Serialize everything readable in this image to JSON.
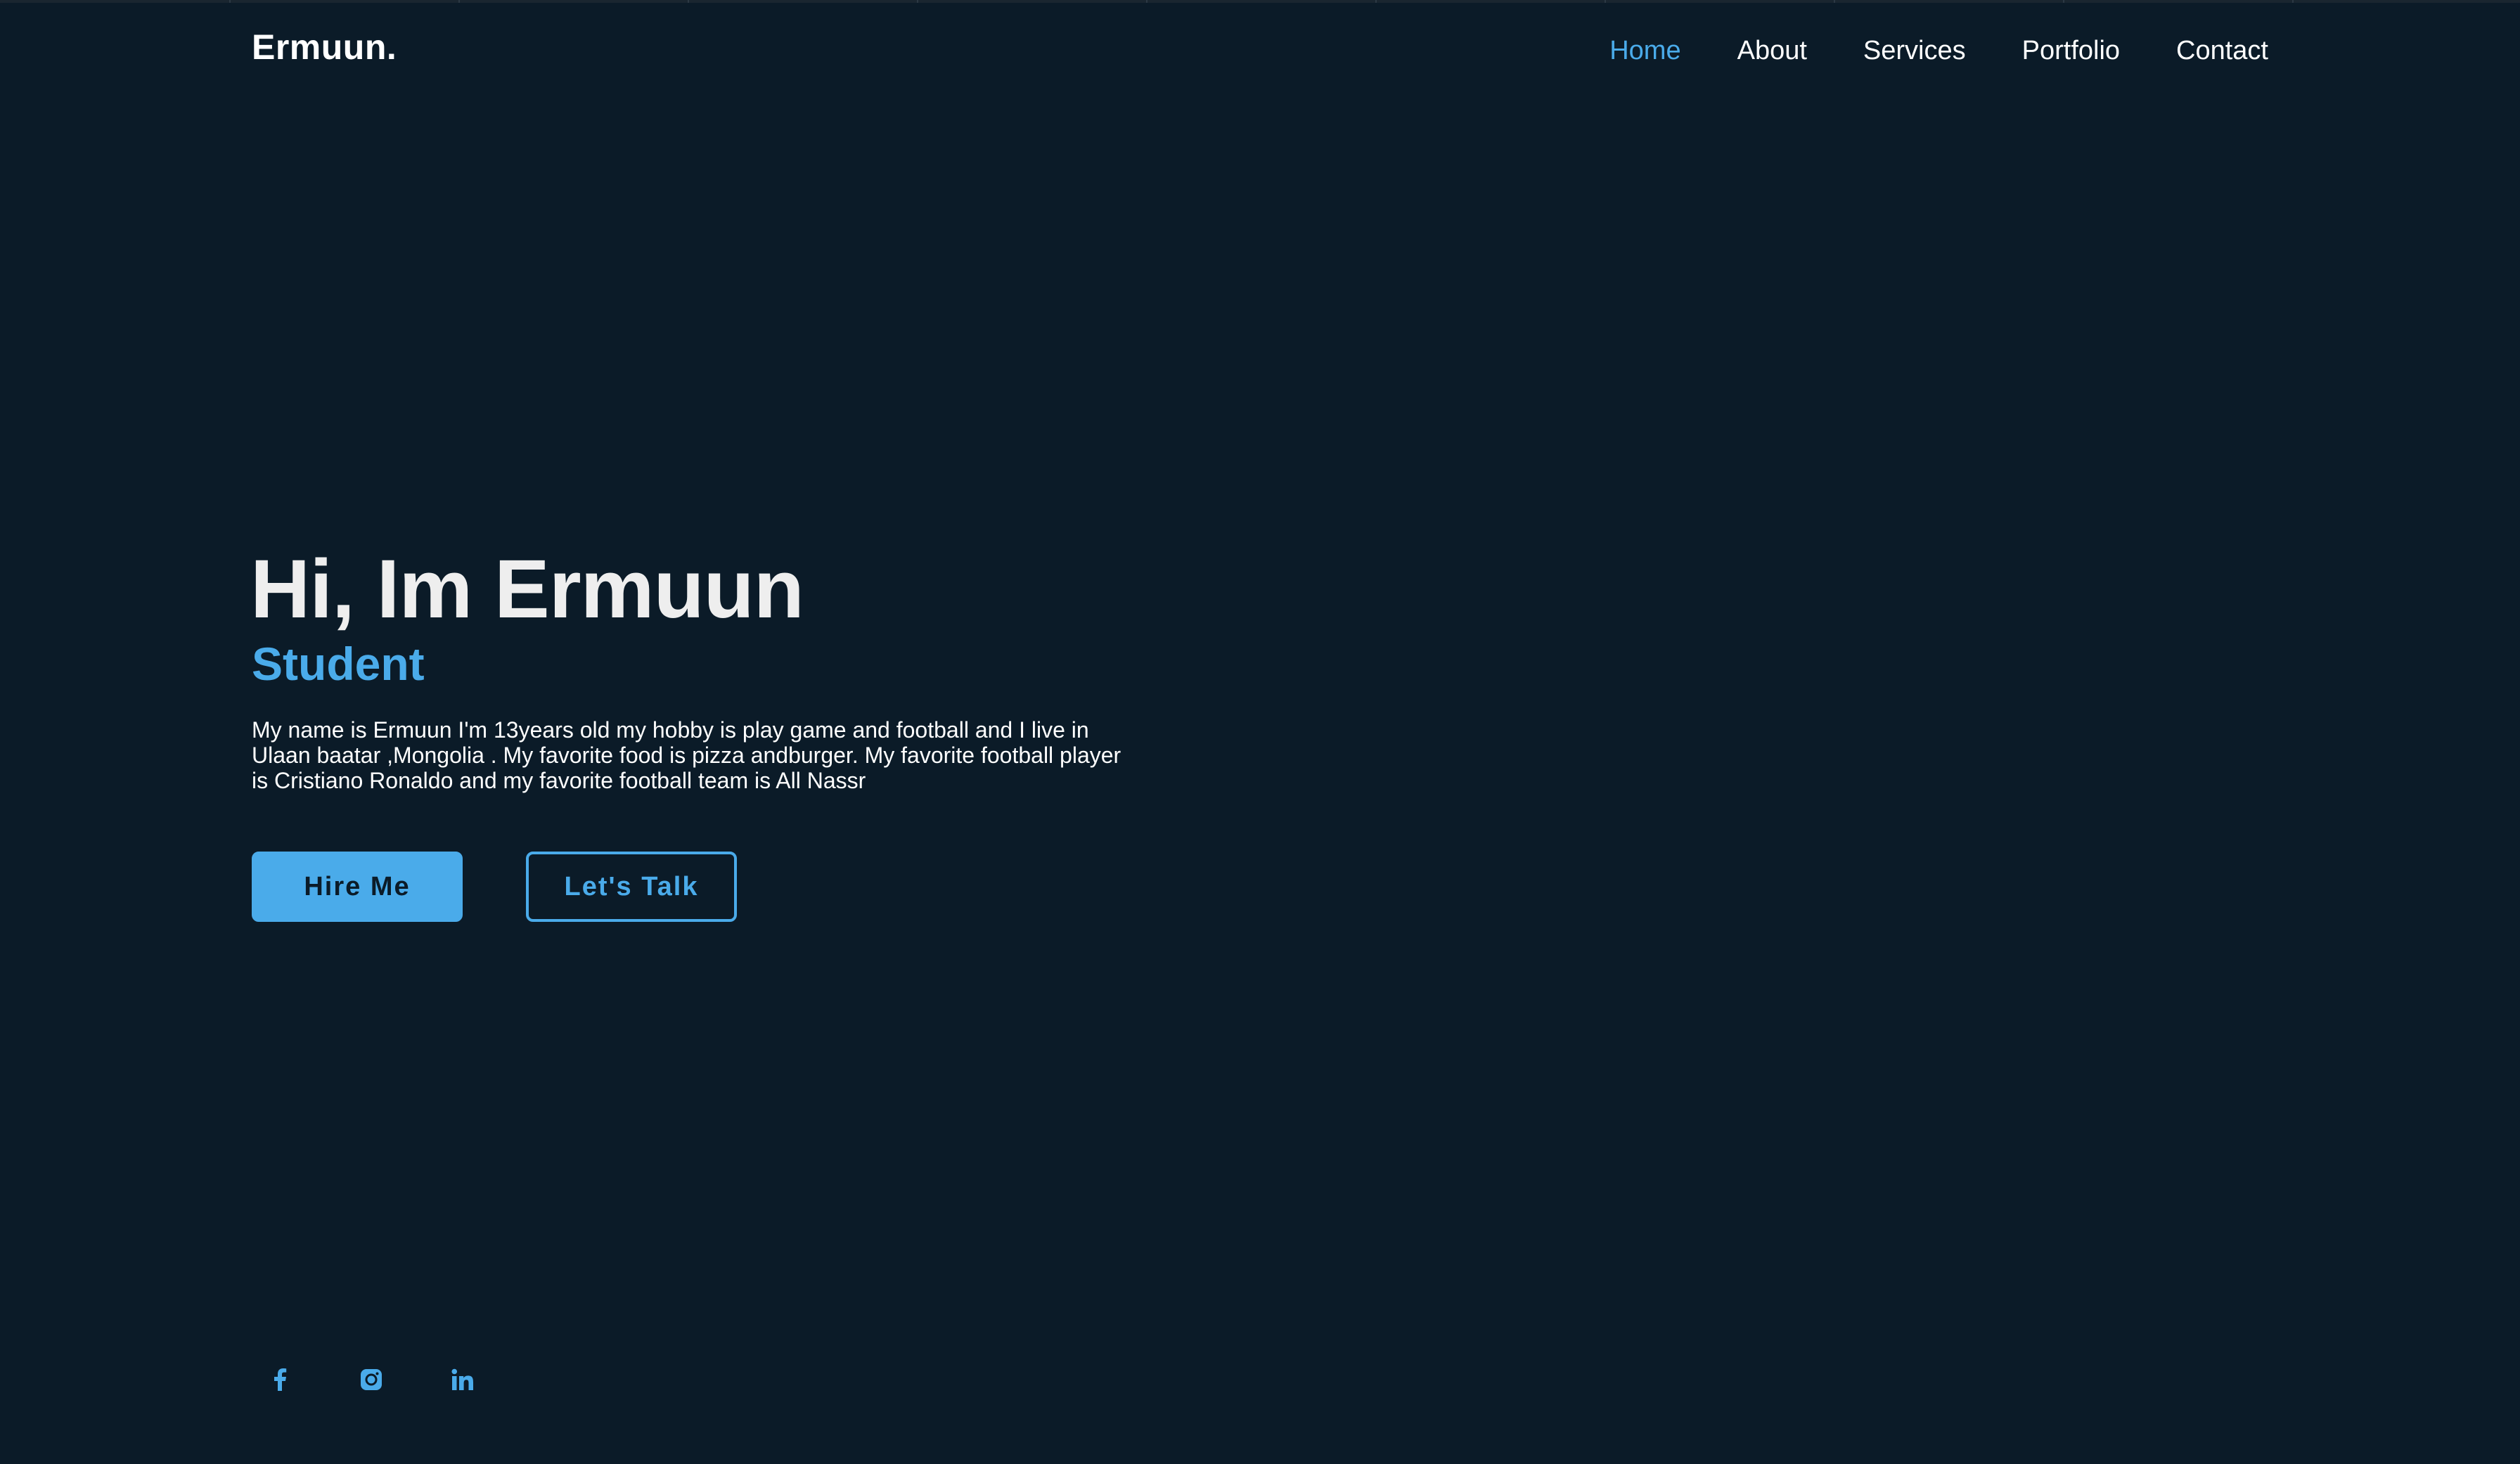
{
  "header": {
    "logo": "Ermuun.",
    "nav": [
      {
        "label": "Home",
        "active": true
      },
      {
        "label": "About",
        "active": false
      },
      {
        "label": "Services",
        "active": false
      },
      {
        "label": "Portfolio",
        "active": false
      },
      {
        "label": "Contact",
        "active": false
      }
    ]
  },
  "hero": {
    "title": "Hi, Im Ermuun",
    "subtitle": "Student",
    "description": "My name is Ermuun I'm 13years old my hobby is play game and football and I live in Ulaan baatar ,Mongolia . My favorite food is pizza andburger. My favorite football player is Cristiano Ronaldo and my favorite football team is All Nassr",
    "primary_button": "Hire Me",
    "secondary_button": "Let's Talk"
  },
  "social": [
    {
      "icon": "facebook-icon"
    },
    {
      "icon": "instagram-icon"
    },
    {
      "icon": "linkedin-icon"
    }
  ],
  "colors": {
    "background": "#0b1b28",
    "accent": "#4aabea",
    "text": "#ffffff",
    "title": "#eeeeee"
  }
}
